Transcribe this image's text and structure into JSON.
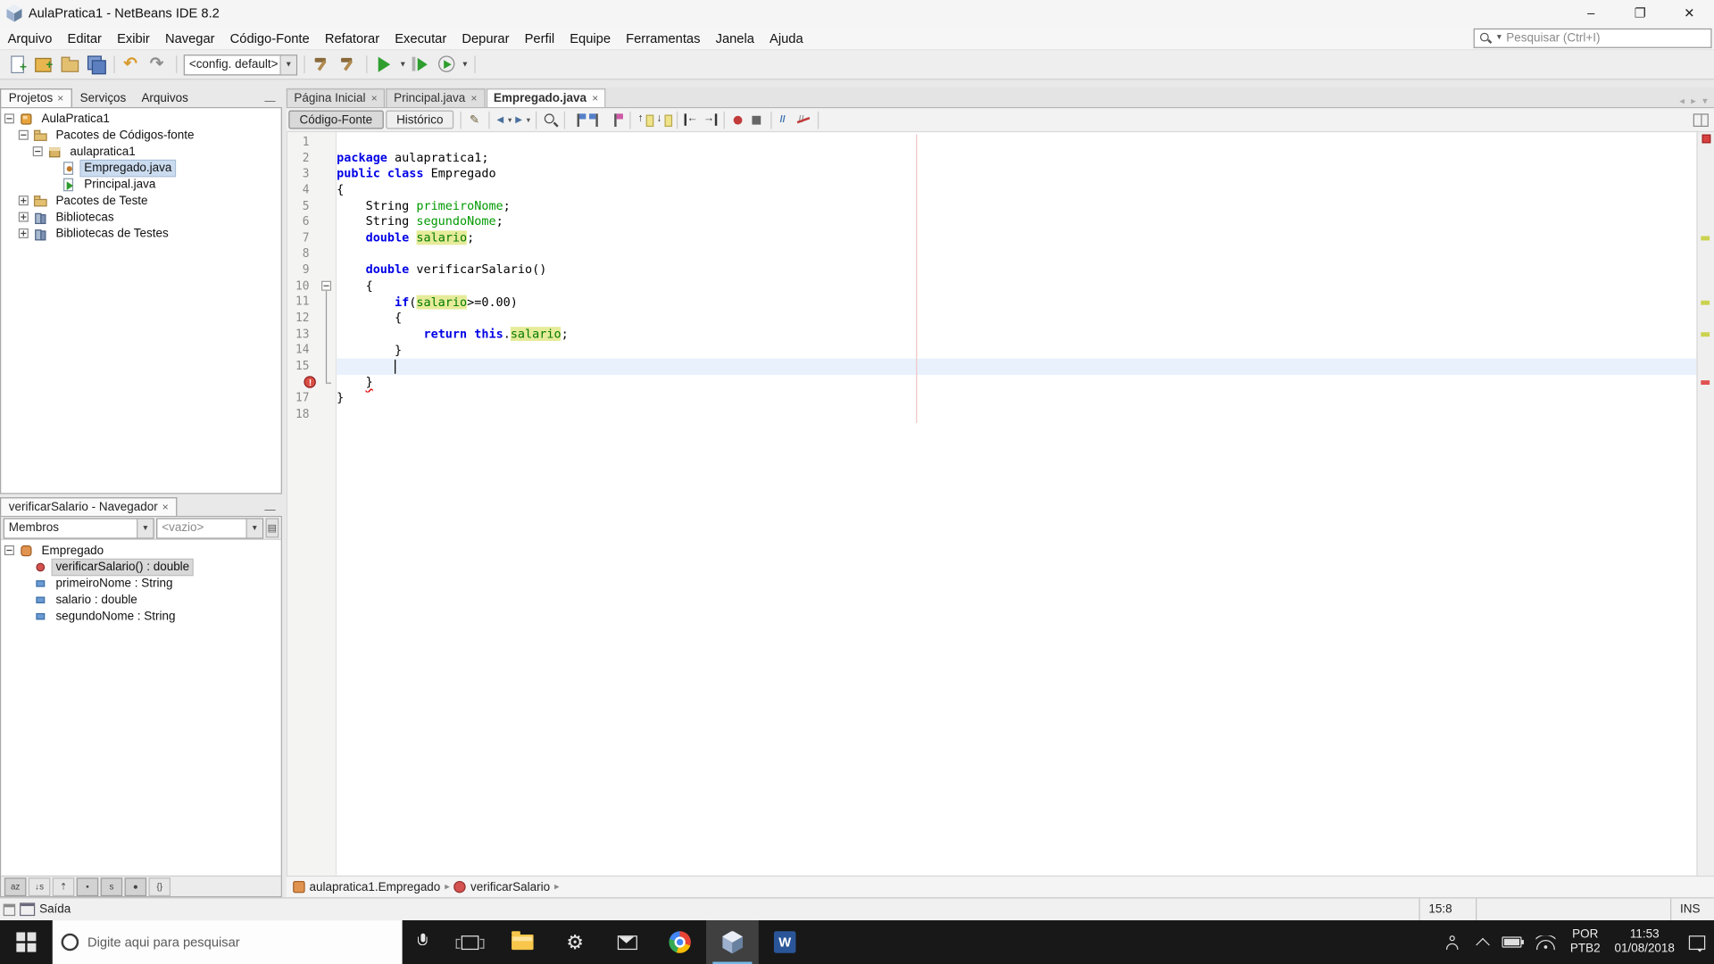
{
  "window": {
    "title": "AulaPratica1 - NetBeans IDE 8.2",
    "controls": {
      "minimize": "–",
      "maximize": "❐",
      "close": "✕"
    }
  },
  "menubar": {
    "items": [
      "Arquivo",
      "Editar",
      "Exibir",
      "Navegar",
      "Código-Fonte",
      "Refatorar",
      "Executar",
      "Depurar",
      "Perfil",
      "Equipe",
      "Ferramentas",
      "Janela",
      "Ajuda"
    ],
    "search_placeholder": "Pesquisar (Ctrl+I)"
  },
  "toolbar": {
    "config_value": "<config. default>",
    "groups": [
      [
        {
          "k": "newfile",
          "n": "new-file"
        },
        {
          "k": "newproj",
          "n": "new-project"
        },
        {
          "k": "openproj",
          "n": "open-project"
        },
        {
          "k": "saveall",
          "n": "save-all"
        }
      ],
      [
        {
          "k": "undo",
          "n": "undo"
        },
        {
          "k": "redo",
          "n": "redo"
        }
      ],
      [
        {
          "k": "build",
          "n": "build-project"
        },
        {
          "k": "build",
          "n": "clean-and-build-project"
        }
      ],
      [
        {
          "k": "run",
          "n": "run-project",
          "dd": true
        },
        {
          "k": "debug",
          "n": "debug-project"
        },
        {
          "k": "profile",
          "n": "profile-project",
          "dd": true
        }
      ]
    ]
  },
  "projects": {
    "tabs": [
      {
        "label": "Projetos",
        "active": true,
        "closable": true
      },
      {
        "label": "Serviços"
      },
      {
        "label": "Arquivos"
      }
    ],
    "tree": [
      {
        "label": "AulaPratica1",
        "level": 0,
        "expanded": true,
        "icon": "project"
      },
      {
        "label": "Pacotes de Códigos-fonte",
        "level": 1,
        "expanded": true,
        "icon": "source-folder"
      },
      {
        "label": "aulapratica1",
        "level": 2,
        "expanded": true,
        "icon": "package"
      },
      {
        "label": "Empregado.java",
        "level": 3,
        "icon": "java-class",
        "selected": true
      },
      {
        "label": "Principal.java",
        "level": 3,
        "icon": "java-main"
      },
      {
        "label": "Pacotes de Teste",
        "level": 1,
        "expanded": false,
        "icon": "test-folder"
      },
      {
        "label": "Bibliotecas",
        "level": 1,
        "expanded": false,
        "icon": "libraries"
      },
      {
        "label": "Bibliotecas de Testes",
        "level": 1,
        "expanded": false,
        "icon": "libraries"
      }
    ]
  },
  "navigator": {
    "title": "verificarSalario - Navegador",
    "members_label": "Membros",
    "filter_value": "<vazio>",
    "tree": [
      {
        "label": "Empregado",
        "level": 0,
        "expanded": true,
        "icon": "nav-class"
      },
      {
        "label": "verificarSalario() : double",
        "level": 1,
        "icon": "method",
        "selected": true
      },
      {
        "label": "primeiroNome : String",
        "level": 1,
        "icon": "field"
      },
      {
        "label": "salario : double",
        "level": 1,
        "icon": "field"
      },
      {
        "label": "segundoNome : String",
        "level": 1,
        "icon": "field"
      }
    ],
    "bottom_icons": [
      {
        "name": "sort-alphabetically",
        "glyph": "az",
        "pressed": true
      },
      {
        "name": "sort-by-source",
        "glyph": "↓s"
      },
      {
        "name": "show-inherited-members",
        "glyph": "⇡"
      },
      {
        "name": "show-fields",
        "glyph": "▪",
        "pressed": true
      },
      {
        "name": "show-static-members",
        "glyph": "s",
        "pressed": true
      },
      {
        "name": "show-non-public-members",
        "glyph": "●",
        "pressed": true
      },
      {
        "name": "fully-qualified-names",
        "glyph": "{}"
      }
    ]
  },
  "editor": {
    "tabs": [
      {
        "label": "Página Inicial"
      },
      {
        "label": "Principal.java"
      },
      {
        "label": "Empregado.java",
        "active": true
      }
    ],
    "views": [
      {
        "label": "Código-Fonte",
        "active": true
      },
      {
        "label": "Histórico"
      }
    ],
    "toolbar_groups": [
      [
        {
          "k": "lastedit",
          "n": "last-edit-position"
        }
      ],
      [
        {
          "k": "back",
          "n": "back"
        },
        {
          "k": "fwd",
          "n": "forward"
        }
      ],
      [
        {
          "k": "findsel",
          "n": "find-selection"
        }
      ],
      [
        {
          "k": "bmprev",
          "n": "previous-bookmark"
        },
        {
          "k": "bmnext",
          "n": "next-bookmark"
        },
        {
          "k": "bmtoggle",
          "n": "toggle-bookmark"
        }
      ],
      [
        {
          "k": "occprev",
          "n": "previous-occurrence"
        },
        {
          "k": "occnext",
          "n": "next-occurrence"
        }
      ],
      [
        {
          "k": "shiftl",
          "n": "shift-line-left"
        },
        {
          "k": "shiftr",
          "n": "shift-line-right"
        }
      ],
      [
        {
          "k": "rec",
          "n": "start-macro-recording"
        },
        {
          "k": "stop",
          "n": "stop-macro-recording"
        }
      ],
      [
        {
          "k": "comment",
          "n": "comment"
        },
        {
          "k": "uncomment",
          "n": "uncomment"
        }
      ]
    ],
    "code": {
      "current_line": 15,
      "caret_col": 8,
      "error_line": 16,
      "margin_col": 80,
      "fold": {
        "from": 10,
        "to": 16
      },
      "stripe_marks": [
        {
          "line": 7,
          "type": "occ"
        },
        {
          "line": 11,
          "type": "occ"
        },
        {
          "line": 13,
          "type": "occ"
        },
        {
          "line": 16,
          "type": "err"
        }
      ],
      "lines": [
        {
          "n": 1,
          "seg": []
        },
        {
          "n": 2,
          "seg": [
            [
              "kw",
              "package"
            ],
            [
              "pl",
              " aulapratica1;"
            ]
          ]
        },
        {
          "n": 3,
          "seg": [
            [
              "kw",
              "public"
            ],
            [
              "pl",
              " "
            ],
            [
              "kw",
              "class"
            ],
            [
              "pl",
              " Empregado"
            ]
          ]
        },
        {
          "n": 4,
          "seg": [
            [
              "pl",
              "{"
            ]
          ]
        },
        {
          "n": 5,
          "seg": [
            [
              "pl",
              "    String "
            ],
            [
              "fld",
              "primeiroNome"
            ],
            [
              "pl",
              ";"
            ]
          ]
        },
        {
          "n": 6,
          "seg": [
            [
              "pl",
              "    String "
            ],
            [
              "fld",
              "segundoNome"
            ],
            [
              "pl",
              ";"
            ]
          ]
        },
        {
          "n": 7,
          "seg": [
            [
              "pl",
              "    "
            ],
            [
              "kw",
              "double"
            ],
            [
              "pl",
              " "
            ],
            [
              "fldhl",
              "salario"
            ],
            [
              "pl",
              ";"
            ]
          ]
        },
        {
          "n": 8,
          "seg": []
        },
        {
          "n": 9,
          "seg": [
            [
              "pl",
              "    "
            ],
            [
              "kw",
              "double"
            ],
            [
              "pl",
              " verificarSalario()"
            ]
          ]
        },
        {
          "n": 10,
          "seg": [
            [
              "pl",
              "    {"
            ]
          ]
        },
        {
          "n": 11,
          "seg": [
            [
              "pl",
              "        "
            ],
            [
              "kw",
              "if"
            ],
            [
              "pl",
              "("
            ],
            [
              "fldhl",
              "salario"
            ],
            [
              "pl",
              ">=0.00)"
            ]
          ]
        },
        {
          "n": 12,
          "seg": [
            [
              "pl",
              "        {"
            ]
          ]
        },
        {
          "n": 13,
          "seg": [
            [
              "pl",
              "            "
            ],
            [
              "kw",
              "return"
            ],
            [
              "pl",
              " "
            ],
            [
              "kw",
              "this"
            ],
            [
              "pl",
              "."
            ],
            [
              "fldhl",
              "salario"
            ],
            [
              "pl",
              ";"
            ]
          ]
        },
        {
          "n": 14,
          "seg": [
            [
              "pl",
              "        }"
            ]
          ]
        },
        {
          "n": 15,
          "seg": []
        },
        {
          "n": 16,
          "seg": [
            [
              "pl",
              "    "
            ],
            [
              "err",
              "}"
            ]
          ]
        },
        {
          "n": 17,
          "seg": [
            [
              "pl",
              "}"
            ]
          ]
        },
        {
          "n": 18,
          "seg": []
        }
      ]
    },
    "breadcrumb": [
      {
        "label": "aulapratica1.Empregado",
        "icon": "cls"
      },
      {
        "label": "verificarSalario",
        "icon": "mth"
      }
    ]
  },
  "statusbar": {
    "output_label": "Saída",
    "caret_pos": "15:8",
    "mode": "INS"
  },
  "taskbar": {
    "search_placeholder": "Digite aqui para pesquisar",
    "apps": [
      {
        "name": "task-view"
      },
      {
        "name": "file-explorer"
      },
      {
        "name": "settings"
      },
      {
        "name": "mail"
      },
      {
        "name": "chrome"
      },
      {
        "name": "netbeans",
        "active": true
      },
      {
        "name": "word",
        "glyph": "W"
      }
    ],
    "tray": {
      "lang_top": "POR",
      "lang_bottom": "PTB2",
      "time": "11:53",
      "date": "01/08/2018"
    }
  },
  "colors": {
    "keyword": "#0000e6",
    "field": "#009900",
    "occurrence_bg": "#e6eb9a",
    "error": "#e00000",
    "current_line_bg": "#e8f1fc",
    "margin_line": "#efc4c4",
    "taskbar_bg": "#181818"
  }
}
